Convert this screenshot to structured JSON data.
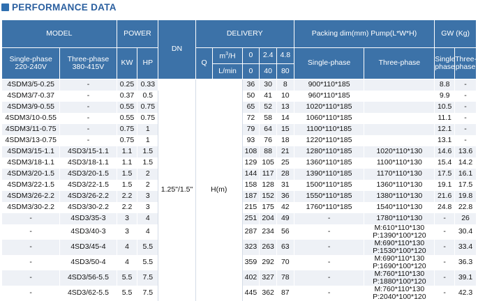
{
  "title": "PERFORMANCE DATA",
  "headers": {
    "model": "MODEL",
    "power": "POWER",
    "dn": "DN",
    "delivery": "DELIVERY",
    "packing": "Packing dim(mm)  Pump(L*W*H)",
    "gw": "GW (Kg)",
    "single_phase_model": "Single-phase 220-240V",
    "three_phase_model": "Three-phase 380-415V",
    "kw": "KW",
    "hp": "HP",
    "q": "Q",
    "m3h": "m3/H",
    "lmin": "L/min",
    "q_m3h": [
      "0",
      "2.4",
      "4.8"
    ],
    "q_lmin": [
      "0",
      "40",
      "80"
    ],
    "single_phase_pack": "Single-phase",
    "three_phase_pack": "Three-phase",
    "gw_single": "Single-phase",
    "gw_three": "Three-phase"
  },
  "dn_value": "1.25\"/1.5\"",
  "h_label": "H(m)",
  "rows": [
    {
      "single": "4SDM3/5-0.25",
      "three": "-",
      "kw": "0.25",
      "hp": "0.33",
      "h0": "36",
      "h1": "30",
      "h2": "8",
      "pack_single": "900*110*185",
      "pack_three": "",
      "gw_single": "8.8",
      "gw_three": "-"
    },
    {
      "single": "4SDM3/7-0.37",
      "three": "-",
      "kw": "0.37",
      "hp": "0.5",
      "h0": "50",
      "h1": "41",
      "h2": "10",
      "pack_single": "960*110*185",
      "pack_three": "",
      "gw_single": "9.9",
      "gw_three": "-"
    },
    {
      "single": "4SDM3/9-0.55",
      "three": "-",
      "kw": "0.55",
      "hp": "0.75",
      "h0": "65",
      "h1": "52",
      "h2": "13",
      "pack_single": "1020*110*185",
      "pack_three": "",
      "gw_single": "10.5",
      "gw_three": "-"
    },
    {
      "single": "4SDM3/10-0.55",
      "three": "-",
      "kw": "0.55",
      "hp": "0.75",
      "h0": "72",
      "h1": "58",
      "h2": "14",
      "pack_single": "1060*110*185",
      "pack_three": "",
      "gw_single": "11.1",
      "gw_three": "-"
    },
    {
      "single": "4SDM3/11-0.75",
      "three": "-",
      "kw": "0.75",
      "hp": "1",
      "h0": "79",
      "h1": "64",
      "h2": "15",
      "pack_single": "1100*110*185",
      "pack_three": "",
      "gw_single": "12.1",
      "gw_three": "-"
    },
    {
      "single": "4SDM3/13-0.75",
      "three": "-",
      "kw": "0.75",
      "hp": "1",
      "h0": "93",
      "h1": "76",
      "h2": "18",
      "pack_single": "1220*110*185",
      "pack_three": "",
      "gw_single": "13.1",
      "gw_three": "-"
    },
    {
      "single": "4SDM3/15-1.1",
      "three": "4SD3/15-1.1",
      "kw": "1.1",
      "hp": "1.5",
      "h0": "108",
      "h1": "88",
      "h2": "21",
      "pack_single": "1280*110*185",
      "pack_three": "1020*110*130",
      "gw_single": "14.6",
      "gw_three": "13.6"
    },
    {
      "single": "4SDM3/18-1.1",
      "three": "4SD3/18-1.1",
      "kw": "1.1",
      "hp": "1.5",
      "h0": "129",
      "h1": "105",
      "h2": "25",
      "pack_single": "1360*110*185",
      "pack_three": "1100*110*130",
      "gw_single": "15.4",
      "gw_three": "14.2"
    },
    {
      "single": "4SDM3/20-1.5",
      "three": "4SD3/20-1.5",
      "kw": "1.5",
      "hp": "2",
      "h0": "144",
      "h1": "117",
      "h2": "28",
      "pack_single": "1390*110*185",
      "pack_three": "1170*110*130",
      "gw_single": "17.5",
      "gw_three": "16.1"
    },
    {
      "single": "4SDM3/22-1.5",
      "three": "4SD3/22-1.5",
      "kw": "1.5",
      "hp": "2",
      "h0": "158",
      "h1": "128",
      "h2": "31",
      "pack_single": "1500*110*185",
      "pack_three": "1360*110*130",
      "gw_single": "19.1",
      "gw_three": "17.5"
    },
    {
      "single": "4SDM3/26-2.2",
      "three": "4SD3/26-2.2",
      "kw": "2.2",
      "hp": "3",
      "h0": "187",
      "h1": "152",
      "h2": "36",
      "pack_single": "1550*110*185",
      "pack_three": "1380*110*130",
      "gw_single": "21.6",
      "gw_three": "19.8"
    },
    {
      "single": "4SDM3/30-2.2",
      "three": "4SD3/30-2.2",
      "kw": "2.2",
      "hp": "3",
      "h0": "215",
      "h1": "175",
      "h2": "42",
      "pack_single": "1760*110*185",
      "pack_three": "1540*110*130",
      "gw_single": "24.8",
      "gw_three": "22.8"
    },
    {
      "single": "-",
      "three": "4SD3/35-3",
      "kw": "3",
      "hp": "4",
      "h0": "251",
      "h1": "204",
      "h2": "49",
      "pack_single": "-",
      "pack_three": "1780*110*130",
      "gw_single": "-",
      "gw_three": "26"
    },
    {
      "single": "-",
      "three": "4SD3/40-3",
      "kw": "3",
      "hp": "4",
      "h0": "287",
      "h1": "234",
      "h2": "56",
      "pack_single": "-",
      "pack_three_m": "M:610*110*130",
      "pack_three_p": "P:1390*100*120",
      "gw_single": "-",
      "gw_three": "30.4"
    },
    {
      "single": "-",
      "three": "4SD3/45-4",
      "kw": "4",
      "hp": "5.5",
      "h0": "323",
      "h1": "263",
      "h2": "63",
      "pack_single": "-",
      "pack_three_m": "M:690*110*130",
      "pack_three_p": "P:1530*100*120",
      "gw_single": "-",
      "gw_three": "33.4"
    },
    {
      "single": "-",
      "three": "4SD3/50-4",
      "kw": "4",
      "hp": "5.5",
      "h0": "359",
      "h1": "292",
      "h2": "70",
      "pack_single": "-",
      "pack_three_m": "M:690*110*130",
      "pack_three_p": "P:1690*100*120",
      "gw_single": "-",
      "gw_three": "36.3"
    },
    {
      "single": "-",
      "three": "4SD3/56-5.5",
      "kw": "5.5",
      "hp": "7.5",
      "h0": "402",
      "h1": "327",
      "h2": "78",
      "pack_single": "-",
      "pack_three_m": "M:760*110*130",
      "pack_three_p": "P:1880*100*120",
      "gw_single": "-",
      "gw_three": "39.1"
    },
    {
      "single": "-",
      "three": "4SD3/62-5.5",
      "kw": "5.5",
      "hp": "7.5",
      "h0": "445",
      "h1": "362",
      "h2": "87",
      "pack_single": "-",
      "pack_three_m": "M:760*110*130",
      "pack_three_p": "P:2040*100*120",
      "gw_single": "-",
      "gw_three": "42.3"
    }
  ],
  "colors": {
    "header_bg": "#3c72a8",
    "title": "#2a5f9f",
    "stripe": "#eef1f6"
  }
}
